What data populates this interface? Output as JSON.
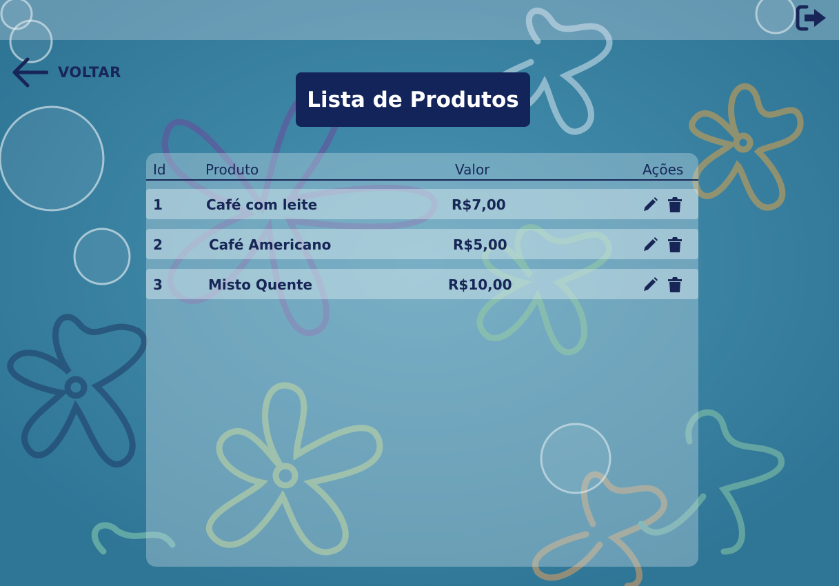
{
  "header": {
    "logout_icon": "sign-out-icon"
  },
  "nav": {
    "back_label": "VOLTAR",
    "back_icon": "arrow-left-icon"
  },
  "page": {
    "title": "Lista de Produtos"
  },
  "table": {
    "columns": [
      "Id",
      "Produto",
      "Valor",
      "Ações"
    ],
    "rows": [
      {
        "id": "1",
        "produto": "Café com leite",
        "valor": "R$7,00"
      },
      {
        "id": "2",
        "produto": "Café Americano",
        "valor": "R$5,00"
      },
      {
        "id": "3",
        "produto": "Misto Quente",
        "valor": "R$10,00"
      }
    ],
    "row_actions": [
      "pencil-icon",
      "trash-icon"
    ]
  },
  "colors": {
    "primary": "#12245a",
    "text": "#172656",
    "background": "#3d86a6"
  }
}
